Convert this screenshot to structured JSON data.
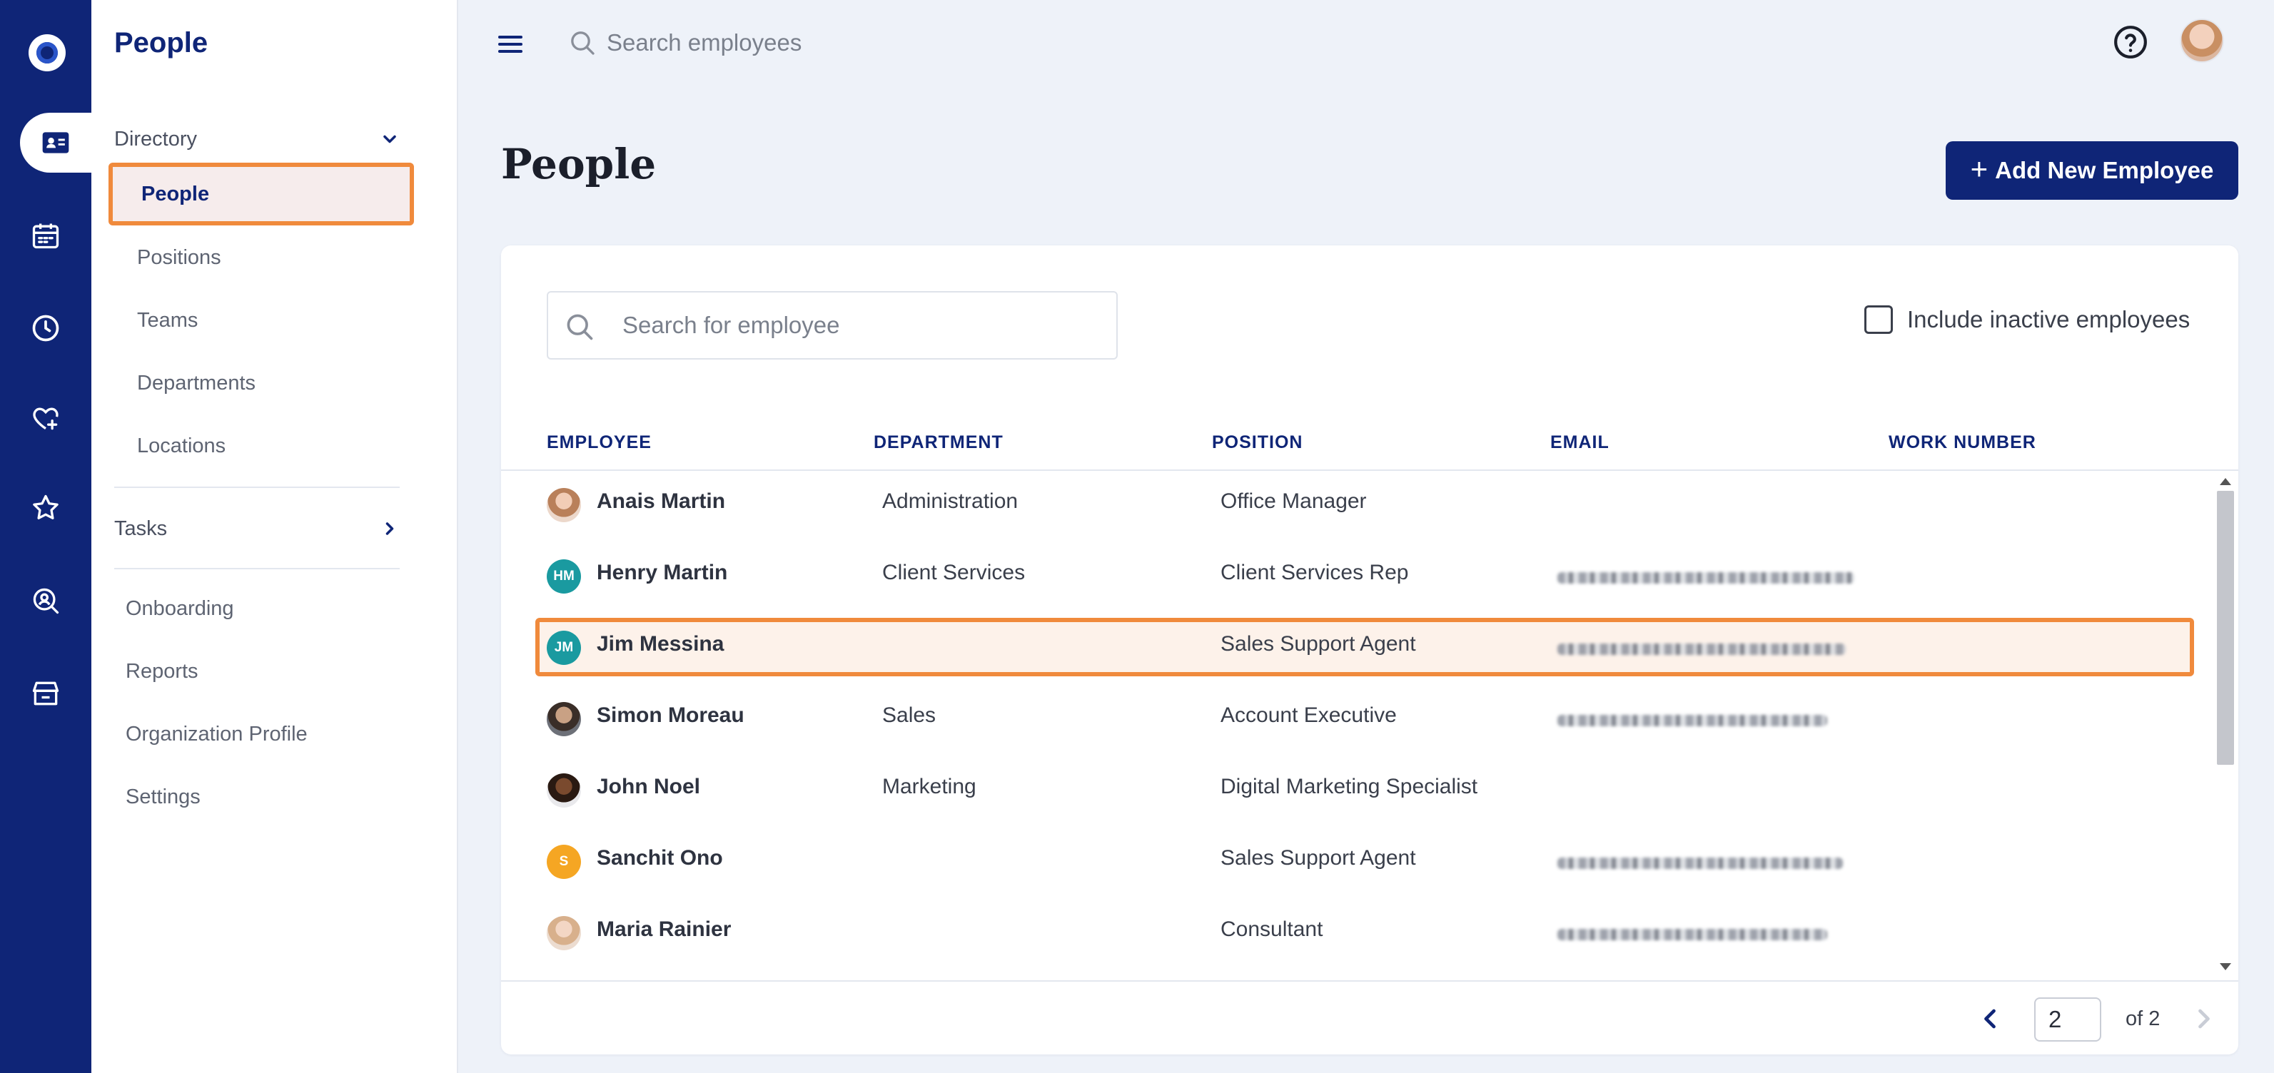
{
  "app": {
    "section_title": "People"
  },
  "colors": {
    "brand_navy": "#0f2577",
    "highlight_orange": "#f08a3c",
    "avatar_teal": "#1a9aa0",
    "avatar_orange": "#f5a623"
  },
  "rail": {
    "items": [
      {
        "icon": "logo-icon"
      },
      {
        "icon": "id-card-icon",
        "active": true
      },
      {
        "icon": "calendar-icon"
      },
      {
        "icon": "clock-icon"
      },
      {
        "icon": "heart-plus-icon"
      },
      {
        "icon": "star-icon"
      },
      {
        "icon": "person-search-icon"
      },
      {
        "icon": "store-icon"
      }
    ]
  },
  "sidebar": {
    "title": "People",
    "directory": {
      "label": "Directory",
      "items": [
        {
          "label": "People",
          "active": true
        },
        {
          "label": "Positions"
        },
        {
          "label": "Teams"
        },
        {
          "label": "Departments"
        },
        {
          "label": "Locations"
        }
      ]
    },
    "tasks": {
      "label": "Tasks"
    },
    "items": [
      {
        "label": "Onboarding"
      },
      {
        "label": "Reports"
      },
      {
        "label": "Organization Profile"
      },
      {
        "label": "Settings"
      }
    ]
  },
  "topbar": {
    "search_placeholder": "Search employees"
  },
  "page": {
    "title": "People",
    "add_button": "Add New Employee",
    "add_button_icon": "+"
  },
  "card": {
    "search_placeholder": "Search for employee",
    "include_inactive_label": "Include inactive employees",
    "include_inactive_checked": false,
    "columns": [
      "EMPLOYEE",
      "DEPARTMENT",
      "POSITION",
      "EMAIL",
      "WORK NUMBER"
    ],
    "rows": [
      {
        "name": "Anais Martin",
        "department": "Administration",
        "position": "Office Manager",
        "email_redacted": false,
        "avatar": "photo",
        "initials": ""
      },
      {
        "name": "Henry Martin",
        "department": "Client Services",
        "position": "Client Services Rep",
        "email_redacted": true,
        "avatar": "initials",
        "initials": "HM"
      },
      {
        "name": "Jim Messina",
        "department": "",
        "position": "Sales Support Agent",
        "email_redacted": true,
        "avatar": "initials",
        "initials": "JM",
        "highlighted": true
      },
      {
        "name": "Simon Moreau",
        "department": "Sales",
        "position": "Account Executive",
        "email_redacted": true,
        "avatar": "photo",
        "initials": ""
      },
      {
        "name": "John Noel",
        "department": "Marketing",
        "position": "Digital Marketing Specialist",
        "email_redacted": false,
        "avatar": "photo",
        "initials": ""
      },
      {
        "name": "Sanchit Ono",
        "department": "",
        "position": "Sales Support Agent",
        "email_redacted": true,
        "avatar": "initials",
        "initials": "S"
      },
      {
        "name": "Maria Rainier",
        "department": "",
        "position": "Consultant",
        "email_redacted": true,
        "avatar": "photo",
        "initials": ""
      }
    ],
    "pagination": {
      "current_page": "2",
      "of_label": "of 2"
    }
  }
}
